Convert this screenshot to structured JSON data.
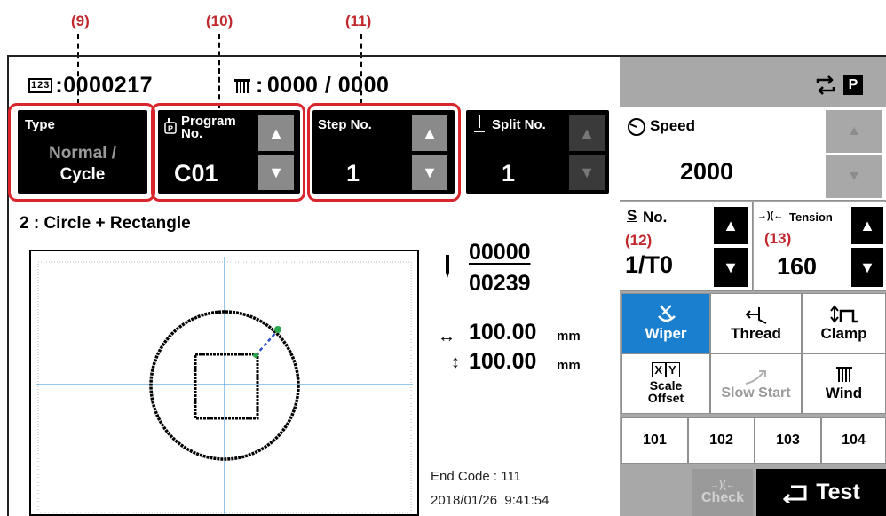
{
  "callouts": {
    "c9": "(9)",
    "c10": "(10)",
    "c11": "(11)",
    "c12": "(12)",
    "c13": "(13)"
  },
  "header": {
    "counter_value": "0000217",
    "bobbin_value": "0000 / 0000",
    "sep": ":"
  },
  "type_box": {
    "label": "Type",
    "line1": "Normal /",
    "line2": "Cycle"
  },
  "program_box": {
    "label": "Program No.",
    "value": "C01"
  },
  "step_box": {
    "label": "Step No.",
    "value": "1"
  },
  "split_box": {
    "label": "Split No.",
    "value": "1"
  },
  "pattern": {
    "title": "2 : Circle + Rectangle"
  },
  "stitch": {
    "current": "00000",
    "total": "00239"
  },
  "size": {
    "width": "100.00",
    "height": "100.00",
    "unit": "mm"
  },
  "footer": {
    "end_code": "End Code : 111",
    "datetime": "2018/01/26  9:41:54"
  },
  "speed": {
    "label": "Speed",
    "value": "2000"
  },
  "s_no": {
    "label": "No.",
    "value": "1/T0"
  },
  "tension": {
    "label": "Tension",
    "value": "160"
  },
  "buttons": {
    "wiper": "Wiper",
    "thread": "Thread",
    "clamp": "Clamp",
    "scale_offset": "Scale Offset",
    "slow_start": "Slow Start",
    "wind": "Wind",
    "check": "Check",
    "test": "Test"
  },
  "presets": [
    "101",
    "102",
    "103",
    "104"
  ],
  "colors": {
    "accent_red": "#d9262c",
    "wiper_blue": "#1b7fcf",
    "crosshair": "#2a8fd8",
    "marker_green": "#2aa84a",
    "panel_grey": "#a8a8a8"
  }
}
